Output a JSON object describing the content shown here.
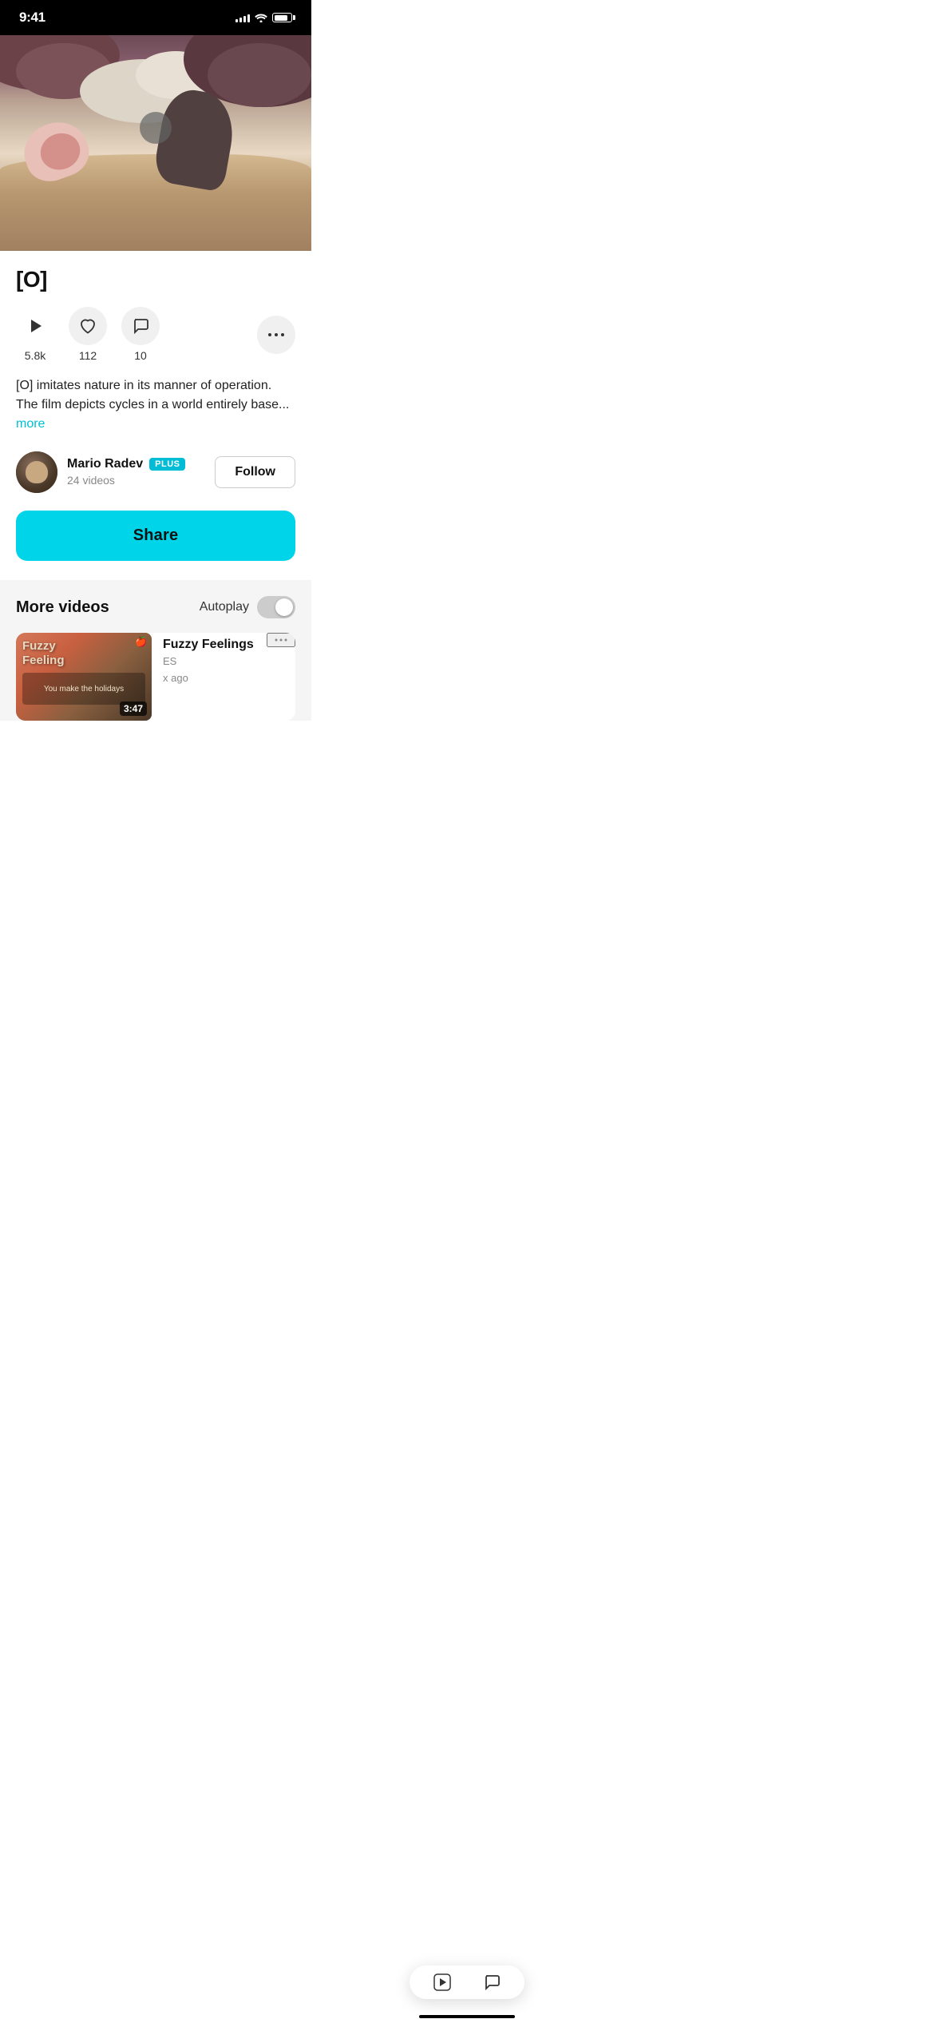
{
  "status_bar": {
    "time": "9:41",
    "signal_bars": [
      4,
      6,
      8,
      10,
      12
    ],
    "wifi": "wifi",
    "battery": "battery"
  },
  "hero": {
    "alt": "Animated desert landscape"
  },
  "video": {
    "title": "[O]",
    "plays": "5.8k",
    "likes": "112",
    "comments": "10",
    "description": "[O] imitates nature in its manner of operation. The film depicts cycles in a world entirely base...",
    "more_label": "more"
  },
  "creator": {
    "name": "Mario Radev",
    "badge": "PLUS",
    "videos": "24 videos",
    "follow_label": "Follow"
  },
  "actions": {
    "play_label": "play",
    "like_label": "like",
    "comment_label": "comment",
    "more_label": "...",
    "share_label": "Share"
  },
  "more_videos": {
    "title": "More videos",
    "autoplay_label": "Autoplay",
    "items": [
      {
        "title": "Fuzzy Feelings",
        "subtitle": "ES",
        "time_ago": "x ago",
        "duration": "3:47",
        "thumb_text": "Fuzzy\nFeeling"
      }
    ]
  },
  "bottom_nav": {
    "play_icon": "▶",
    "comment_icon": "💬"
  }
}
